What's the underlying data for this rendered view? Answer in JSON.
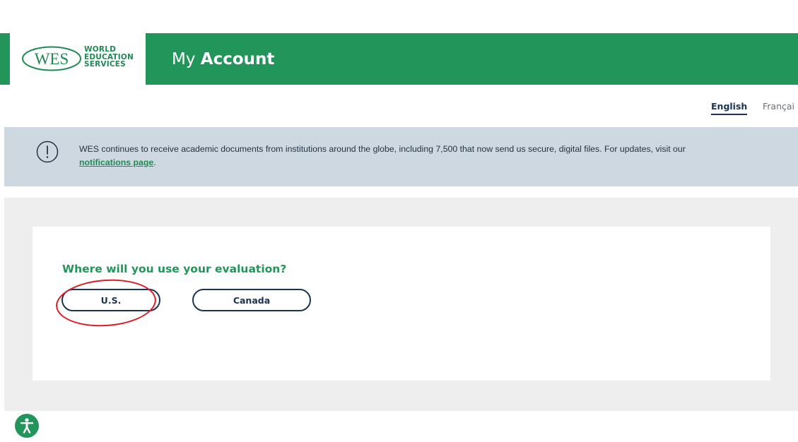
{
  "header": {
    "logo_mark": "WES",
    "logo_words": [
      "WORLD",
      "EDUCATION",
      "SERVICES"
    ],
    "title_light": "My",
    "title_bold": "Account"
  },
  "language": {
    "selected": "English",
    "other": "Françai"
  },
  "notice": {
    "icon": "alert-circle-icon",
    "text": "WES continues to receive academic documents from institutions around the globe, including 7,500 that now send us secure, digital files. For updates, visit our",
    "link_text": "notifications page",
    "trailing": "."
  },
  "evaluation": {
    "question": "Where will you use your evaluation?",
    "options": [
      "U.S.",
      "Canada"
    ],
    "highlighted_option": "U.S."
  },
  "accessibility": {
    "icon": "accessibility-icon"
  },
  "colors": {
    "brand_green": "#22955a",
    "navy": "#1a3355",
    "notice_bg": "#cdd8e1",
    "section_bg": "#eeeeee",
    "annotation_red": "#e01b22"
  }
}
